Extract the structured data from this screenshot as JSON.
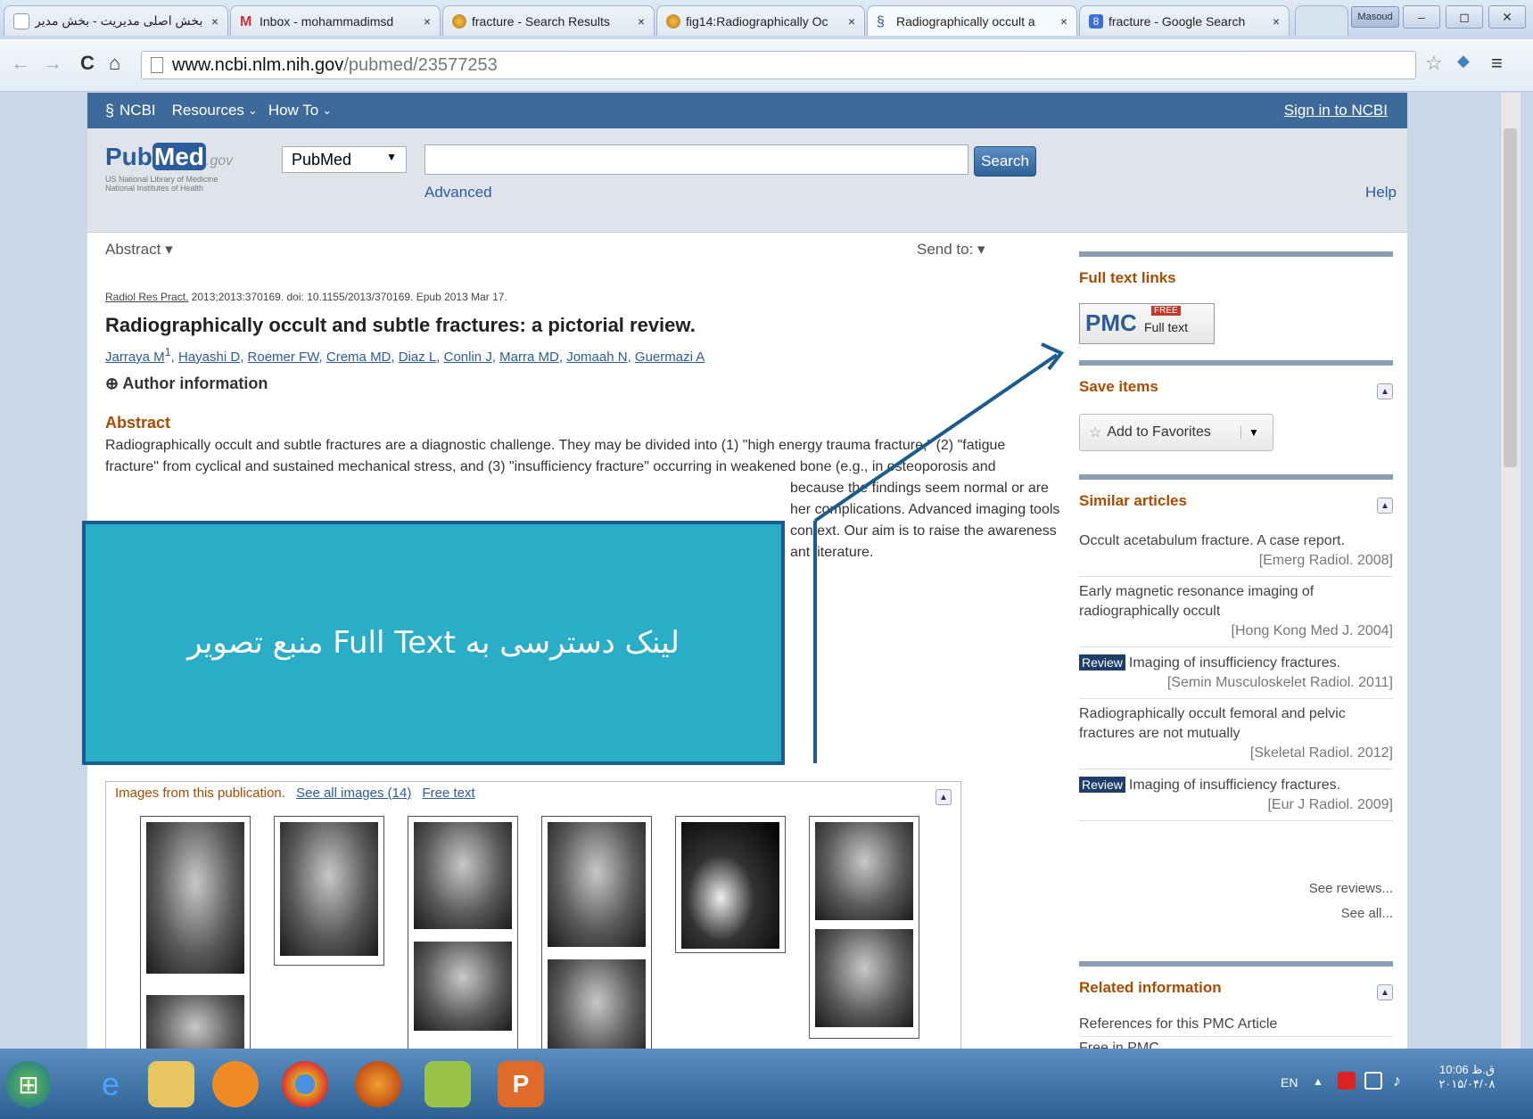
{
  "tabs": [
    {
      "title": "بخش اصلی مدیریت - بخش مدیر",
      "icon": "page-icon",
      "active": false
    },
    {
      "title": "Inbox - mohammadimsd",
      "icon": "gmail-icon",
      "active": false
    },
    {
      "title": "fracture - Search Results",
      "icon": "openi-icon",
      "active": false
    },
    {
      "title": "fig14:Radiographically Oc",
      "icon": "openi-icon",
      "active": false
    },
    {
      "title": "Radiographically occult a",
      "icon": "ncbi-icon",
      "active": true
    },
    {
      "title": "fracture - Google Search",
      "icon": "google-icon",
      "active": false
    }
  ],
  "window": {
    "user_badge": "Masoud",
    "minimize": "–",
    "maximize": "◻",
    "close": "✕"
  },
  "toolbar": {
    "back": "←",
    "forward": "→",
    "reload": "C",
    "home": "⌂",
    "url_host": "www.ncbi.nlm.nih.gov",
    "url_path": "/pubmed/23577253",
    "star": "☆",
    "menu": "≡"
  },
  "ncbi": {
    "logo": "NCBI",
    "resources": "Resources",
    "howto": "How To",
    "signin": "Sign in to NCBI"
  },
  "pubmed": {
    "logo_pub": "Pub",
    "logo_med": "Med",
    "logo_gov": ".gov",
    "lib1": "US National Library of Medicine",
    "lib2": "National Institutes of Health",
    "db": "PubMed",
    "search_value": "",
    "search_btn": "Search",
    "advanced": "Advanced",
    "help": "Help"
  },
  "article": {
    "format": "Abstract",
    "sendto": "Send to:",
    "citation_journal": "Radiol Res Pract.",
    "citation_rest": " 2013;2013:370169. doi: 10.1155/2013/370169. Epub 2013 Mar 17.",
    "title": "Radiographically occult and subtle fractures: a pictorial review.",
    "authors": [
      "Jarraya M",
      "Hayashi D",
      "Roemer FW",
      "Crema MD",
      "Diaz L",
      "Conlin J",
      "Marra MD",
      "Jomaah N",
      "Guermazi A"
    ],
    "author_info": "Author information",
    "abstract_heading": "Abstract",
    "abstract_line1": "Radiographically occult and subtle fractures are a diagnostic challenge. They may be divided into (1) \"high energy trauma fracture,\" (2) \"fatigue",
    "abstract_line2": "fracture\" from cyclical and sustained mechanical stress, and (3) \"insufficiency fracture\" occurring in weakened bone (e.g., in osteoporosis and",
    "abstract_line3": "because the findings seem normal or are",
    "abstract_line4": "her complications. Advanced imaging tools",
    "abstract_line5": "context. Our aim is to raise the awareness",
    "abstract_line6": "ant literature.",
    "images_label": "Images from this publication.",
    "see_all_images": "See all images (14)",
    "free_text": "Free text"
  },
  "sidebar": {
    "fulltext_heading": "Full text links",
    "pmc": "PMC",
    "free": "FREE",
    "full_text": "Full text",
    "save_heading": "Save items",
    "add_fav": "Add to Favorites",
    "similar_heading": "Similar articles",
    "similar": [
      {
        "title": "Occult acetabulum fracture. A case report.",
        "source": "[Emerg Radiol. 2008]",
        "review": false
      },
      {
        "title": "Early magnetic resonance imaging of radiographically occult",
        "source": "[Hong Kong Med J. 2004]",
        "review": false
      },
      {
        "title": "Imaging of insufficiency fractures.",
        "source": "[Semin Musculoskelet Radiol. 2011]",
        "review": true
      },
      {
        "title": "Radiographically occult femoral and pelvic fractures are not mutually",
        "source": "[Skeletal Radiol. 2012]",
        "review": false
      },
      {
        "title": "Imaging of insufficiency fractures.",
        "source": "[Eur J Radiol. 2009]",
        "review": true
      }
    ],
    "review_badge": "Review",
    "see_reviews": "See reviews...",
    "see_all": "See all...",
    "related_heading": "Related information",
    "related": [
      "References for this PMC Article",
      "Free in PMC"
    ]
  },
  "callout": {
    "text": "لینک دسترسی به Full Text منبع تصویر"
  },
  "taskbar": {
    "lang": "EN",
    "time": "10:06 ق.ظ",
    "date": "۲۰۱۵/۰۴/۰۸"
  },
  "colors": {
    "callout_bg": "#2aaec8",
    "callout_border": "#1a5c8e",
    "arrow": "#1a5c8e",
    "ncbi_bar": "#3e6a99"
  }
}
